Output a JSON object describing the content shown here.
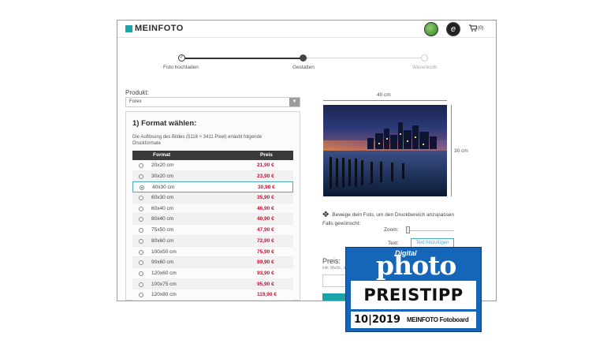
{
  "header": {
    "logo_text": "MEINFOTO",
    "badge_right_letter": "e",
    "cart_count": "(0)",
    "icons": [
      "seal-badge-icon",
      "e-badge-icon",
      "cart-icon"
    ]
  },
  "steps": [
    {
      "label": "Foto hochladen",
      "state": "done",
      "mark": "✓"
    },
    {
      "label": "Gestalten",
      "state": "current"
    },
    {
      "label": "Warenkorb",
      "state": "todo"
    }
  ],
  "product": {
    "label": "Produkt:",
    "selected": "Forex"
  },
  "format": {
    "title": "1) Format wählen:",
    "description": "Die Auflösung des Bildes (5116 × 3411 Pixel) erlaubt folgende Druckformate",
    "col_format": "Format",
    "col_price": "Preis",
    "rows": [
      {
        "size": "20x20 cm",
        "price": "21,90 €"
      },
      {
        "size": "30x20 cm",
        "price": "23,90 €"
      },
      {
        "size": "40x30 cm",
        "price": "30,90 €",
        "selected": true
      },
      {
        "size": "60x30 cm",
        "price": "35,90 €"
      },
      {
        "size": "60x40 cm",
        "price": "46,90 €"
      },
      {
        "size": "80x40 cm",
        "price": "40,90 €"
      },
      {
        "size": "75x50 cm",
        "price": "47,90 €"
      },
      {
        "size": "80x60 cm",
        "price": "72,90 €"
      },
      {
        "size": "100x50 cm",
        "price": "75,90 €"
      },
      {
        "size": "90x60 cm",
        "price": "89,90 €"
      },
      {
        "size": "120x60 cm",
        "price": "93,90 €"
      },
      {
        "size": "100x75 cm",
        "price": "95,90 €"
      },
      {
        "size": "120x80 cm",
        "price": "119,90 €"
      }
    ]
  },
  "preview": {
    "width_label": "40 cm",
    "height_label": "30 cm",
    "move_hint": "Bewege dein Foto, um den Druckbereich anzupassen",
    "falls_label": "Falls gewünscht:",
    "zoom_label": "Zoom:",
    "zoom_value": 0.03,
    "text_label": "Text:",
    "text_button": "Text hinzufügen",
    "price_label": "Preis:",
    "price_sub": "inkl. MwSt., zzgl."
  },
  "award": {
    "brand_small": "Digital",
    "brand": "photo",
    "title": "PREISTIPP",
    "issue": "10|2019",
    "product": "MEINFOTO Fotoboard"
  },
  "colors": {
    "accent": "#1aa3a8",
    "price_red": "#c8102e",
    "award_blue": "#1565b8"
  }
}
